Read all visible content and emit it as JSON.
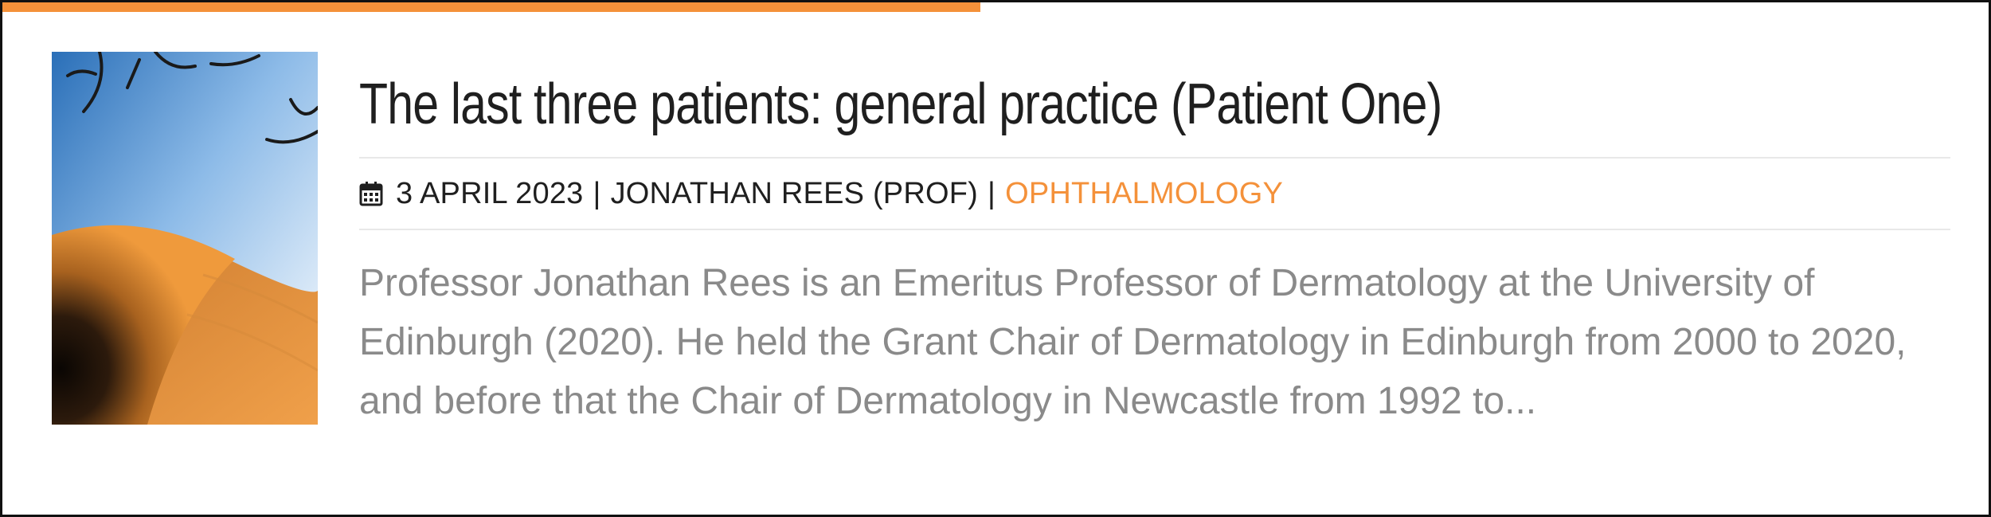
{
  "post": {
    "title": "The last three patients: general practice (Patient One)",
    "date": "3 APRIL 2023",
    "separator": "|",
    "author": "JONATHAN REES (PROF)",
    "category": "OPHTHALMOLOGY",
    "excerpt": "Professor Jonathan Rees is an Emeritus Professor of Dermatology at the University of Edinburgh (2020). He held the Grant Chair of Dermatology in Edinburgh from 2000 to 2020, and before that the Chair of Dermatology in Newcastle from 1992 to...",
    "icons": {
      "date": "calendar-icon"
    },
    "colors": {
      "accent": "#f4913a",
      "title": "#1f1f1f",
      "excerpt": "#8a8a8a"
    }
  }
}
